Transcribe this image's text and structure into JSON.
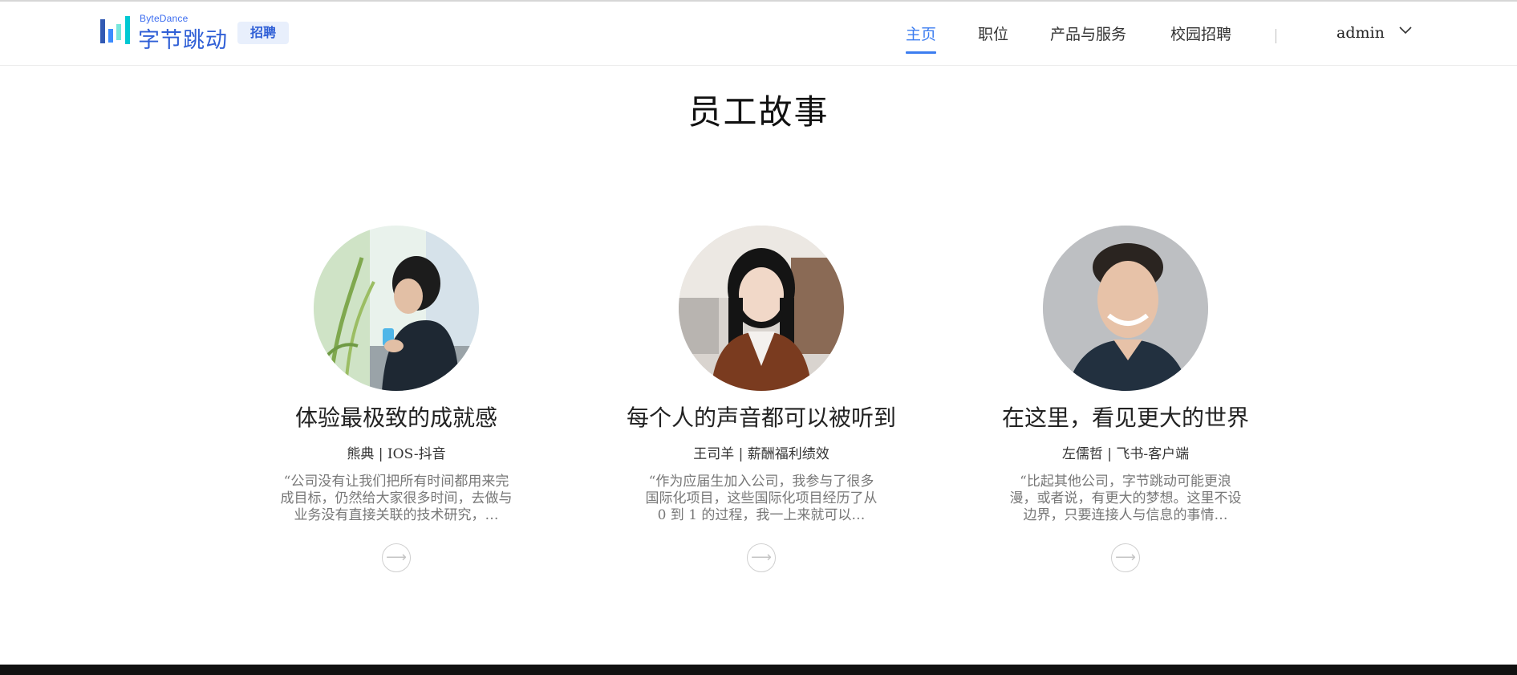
{
  "header": {
    "logo": {
      "en": "ByteDance",
      "cn": "字节跳动",
      "tag": "招聘"
    },
    "nav": [
      {
        "label": "主页",
        "active": true
      },
      {
        "label": "职位",
        "active": false
      },
      {
        "label": "产品与服务",
        "active": false
      },
      {
        "label": "校园招聘",
        "active": false
      }
    ],
    "user": {
      "name": "admin"
    },
    "accent_color": "#3c7df0"
  },
  "section": {
    "title": "员工故事"
  },
  "stories": [
    {
      "title": "体验最极致的成就感",
      "meta": "熊典 | IOS-抖音",
      "quote": "“公司没有让我们把所有时间都用来完成目标，仍然给大家很多时间，去做与业务没有直接关联的技术研究，…"
    },
    {
      "title": "每个人的声音都可以被听到",
      "meta": "王司羊 | 薪酬福利绩效",
      "quote": "“作为应届生加入公司，我参与了很多国际化项目，这些国际化项目经历了从 0 到 1 的过程，我一上来就可以…"
    },
    {
      "title": "在这里，看见更大的世界",
      "meta": "左儒哲 | 飞书-客户端",
      "quote": "“比起其他公司，字节跳动可能更浪漫，或者说，有更大的梦想。这里不设边界，只要连接人与信息的事情…"
    }
  ],
  "icons": {
    "logo": "bytedance-logo-icon",
    "dropdown": "chevron-down-icon",
    "arrow": "arrow-right-icon"
  }
}
